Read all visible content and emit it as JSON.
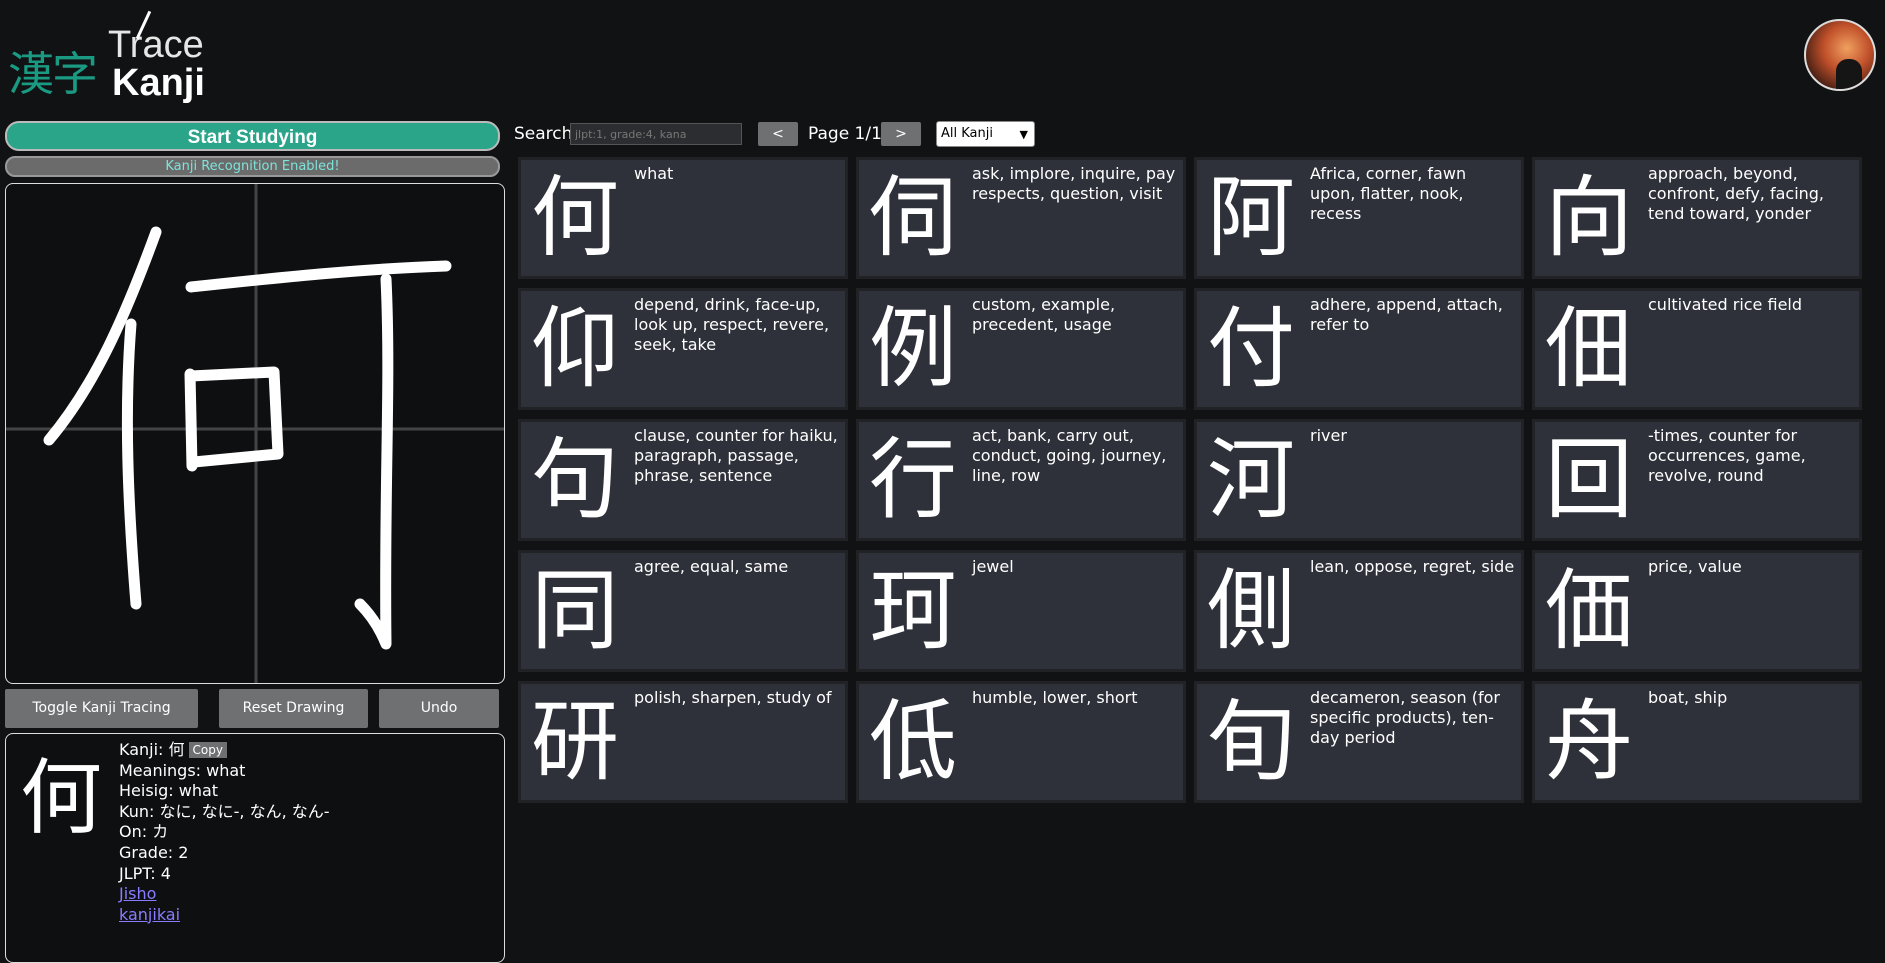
{
  "logo": {
    "kanji": "漢字",
    "trace": "Trace",
    "word": "Kanji"
  },
  "start_button": "Start Studying",
  "recognition_status": "Kanji Recognition Enabled!",
  "canvas": {
    "drawn_kanji": "何"
  },
  "tools": {
    "toggle": "Toggle Kanji Tracing",
    "reset": "Reset Drawing",
    "undo": "Undo"
  },
  "info": {
    "kanji": "何",
    "kanji_line_prefix": "Kanji: 何",
    "copy_label": "Copy",
    "meanings": "Meanings: what",
    "heisig": "Heisig: what",
    "kun": "Kun: なに, なに-, なん, なん-",
    "on": "On: カ",
    "grade": "Grade: 2",
    "jlpt": "JLPT: 4",
    "jisho": "Jisho",
    "kanjikai": "kanjikai"
  },
  "search": {
    "label": "Search",
    "placeholder": "jlpt:1, grade:4, kana",
    "value": ""
  },
  "pagination": {
    "prev": "<",
    "next": ">",
    "page": "Page 1/1"
  },
  "filter": {
    "selected": "All Kanji"
  },
  "cards": [
    {
      "kanji": "何",
      "meanings": "what"
    },
    {
      "kanji": "伺",
      "meanings": "ask, implore, inquire, pay respects, question, visit"
    },
    {
      "kanji": "阿",
      "meanings": "Africa, corner, fawn upon, flatter, nook, recess"
    },
    {
      "kanji": "向",
      "meanings": "approach, beyond, confront, defy, facing, tend toward, yonder"
    },
    {
      "kanji": "仰",
      "meanings": "depend, drink, face-up, look up, respect, revere, seek, take"
    },
    {
      "kanji": "例",
      "meanings": "custom, example, precedent, usage"
    },
    {
      "kanji": "付",
      "meanings": "adhere, append, attach, refer to"
    },
    {
      "kanji": "佃",
      "meanings": "cultivated rice field"
    },
    {
      "kanji": "句",
      "meanings": "clause, counter for haiku, paragraph, passage, phrase, sentence"
    },
    {
      "kanji": "行",
      "meanings": "act, bank, carry out, conduct, going, journey, line, row"
    },
    {
      "kanji": "河",
      "meanings": "river"
    },
    {
      "kanji": "回",
      "meanings": "-times, counter for occurrences, game, revolve, round"
    },
    {
      "kanji": "同",
      "meanings": "agree, equal, same"
    },
    {
      "kanji": "珂",
      "meanings": "jewel"
    },
    {
      "kanji": "側",
      "meanings": "lean, oppose, regret, side"
    },
    {
      "kanji": "価",
      "meanings": "price, value"
    },
    {
      "kanji": "研",
      "meanings": "polish, sharpen, study of"
    },
    {
      "kanji": "低",
      "meanings": "humble, lower, short"
    },
    {
      "kanji": "旬",
      "meanings": "decameron, season (for specific products), ten-day period"
    },
    {
      "kanji": "舟",
      "meanings": "boat, ship"
    }
  ]
}
